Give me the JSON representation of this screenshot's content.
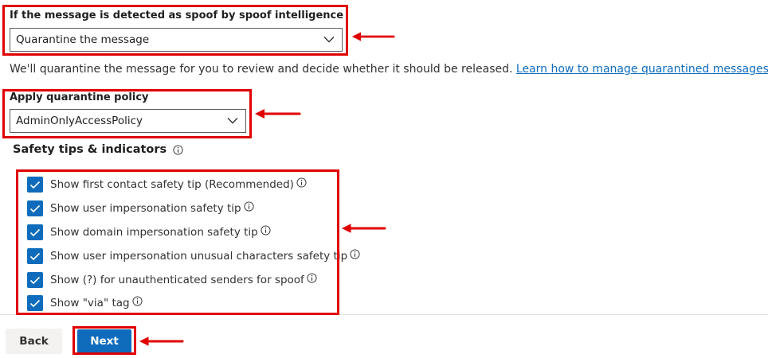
{
  "spoof": {
    "label": "If the message is detected as spoof by spoof intelligence",
    "selected": "Quarantine the message",
    "description": "We'll quarantine the message for you to review and decide whether it should be released.",
    "link": "Learn how to manage quarantined messages"
  },
  "quarantine_policy": {
    "label": "Apply quarantine policy",
    "selected": "AdminOnlyAccessPolicy"
  },
  "safety_tips": {
    "heading": "Safety tips & indicators",
    "items": [
      {
        "label": "Show first contact safety tip (Recommended)",
        "checked": true
      },
      {
        "label": "Show user impersonation safety tip",
        "checked": true
      },
      {
        "label": "Show domain impersonation safety tip",
        "checked": true
      },
      {
        "label": "Show user impersonation unusual characters safety tip",
        "checked": true
      },
      {
        "label": "Show (?) for unauthenticated senders for spoof",
        "checked": true
      },
      {
        "label": "Show \"via\" tag",
        "checked": true
      }
    ]
  },
  "footer": {
    "back_label": "Back",
    "next_label": "Next"
  },
  "colors": {
    "accent": "#0f6cbd",
    "annotation": "#e00000"
  }
}
